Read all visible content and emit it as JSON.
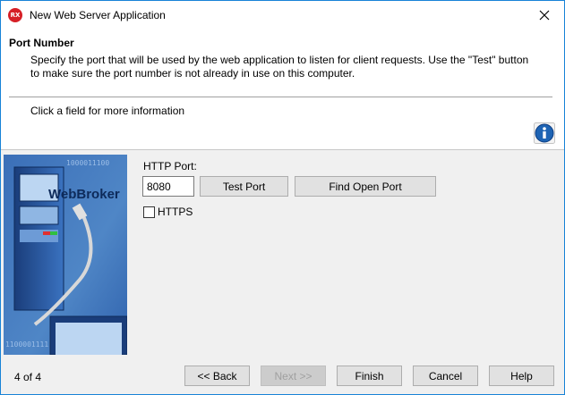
{
  "window": {
    "title": "New Web Server Application",
    "app_icon_text": "RX"
  },
  "header": {
    "title": "Port Number",
    "description": "Specify the port that will be used by the web application to listen for client requests.  Use the \"Test\" button to make sure the port number is not already in use on this computer.",
    "info_text": "Click a field for more information"
  },
  "side_image": {
    "caption": "WebBroker",
    "binary_top": "1000011100",
    "binary_bottom": "1100001111"
  },
  "form": {
    "http_port_label": "HTTP Port:",
    "http_port_value": "8080",
    "test_port_label": "Test Port",
    "find_open_port_label": "Find Open Port",
    "https_label": "HTTPS",
    "https_checked": false
  },
  "footer": {
    "step": "4 of 4",
    "back_label": "<< Back",
    "next_label": "Next >>",
    "finish_label": "Finish",
    "cancel_label": "Cancel",
    "help_label": "Help"
  },
  "colors": {
    "window_border": "#1883d7",
    "app_icon": "#d61f26",
    "info_icon": "#1e64b4",
    "side_bg": "#2f62ad"
  },
  "icons": {
    "close": "close-icon",
    "info": "info-icon",
    "app": "rx-app-icon"
  }
}
